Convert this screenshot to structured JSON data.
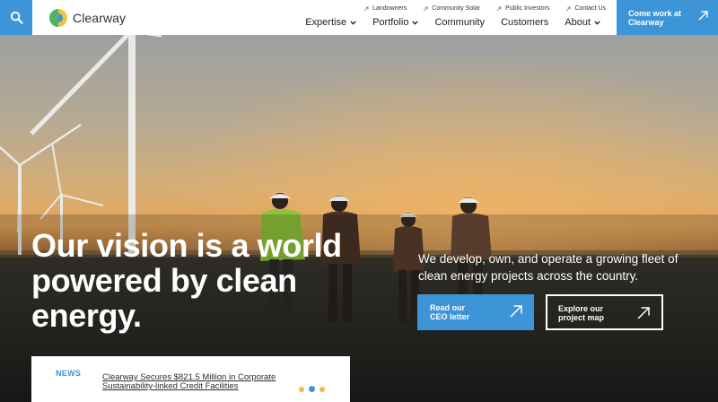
{
  "header": {
    "logo_text": "Clearway",
    "utility_links": [
      {
        "label": "Landowners"
      },
      {
        "label": "Community Solar"
      },
      {
        "label": "Public Investors"
      },
      {
        "label": "Contact Us"
      }
    ],
    "nav": [
      {
        "label": "Expertise",
        "has_dropdown": true
      },
      {
        "label": "Portfolio",
        "has_dropdown": true
      },
      {
        "label": "Community",
        "has_dropdown": false
      },
      {
        "label": "Customers",
        "has_dropdown": false
      },
      {
        "label": "About",
        "has_dropdown": true
      }
    ],
    "cta": {
      "line1": "Come work at",
      "line2": "Clearway"
    }
  },
  "hero": {
    "headline": [
      "Our vision is a world",
      "powered by clean",
      "energy."
    ],
    "subhead": "We develop, own, and operate a growing fleet of clean energy projects across the country.",
    "buttons": {
      "ceo": {
        "line1": "Read our",
        "line2": "CEO letter"
      },
      "map": {
        "line1": "Explore our",
        "line2": "project map"
      }
    }
  },
  "news": {
    "label": "NEWS",
    "headline": "Clearway Secures $821.5 Million in Corporate Sustainability-linked Credit Facilities",
    "carousel_count": 3,
    "active_index": 1
  },
  "colors": {
    "accent": "#3d95d8",
    "logo_green": "#4db36b",
    "logo_yellow": "#f2c33c",
    "logo_blue": "#3d95d8",
    "dot_inactive": "#f0b74a"
  }
}
